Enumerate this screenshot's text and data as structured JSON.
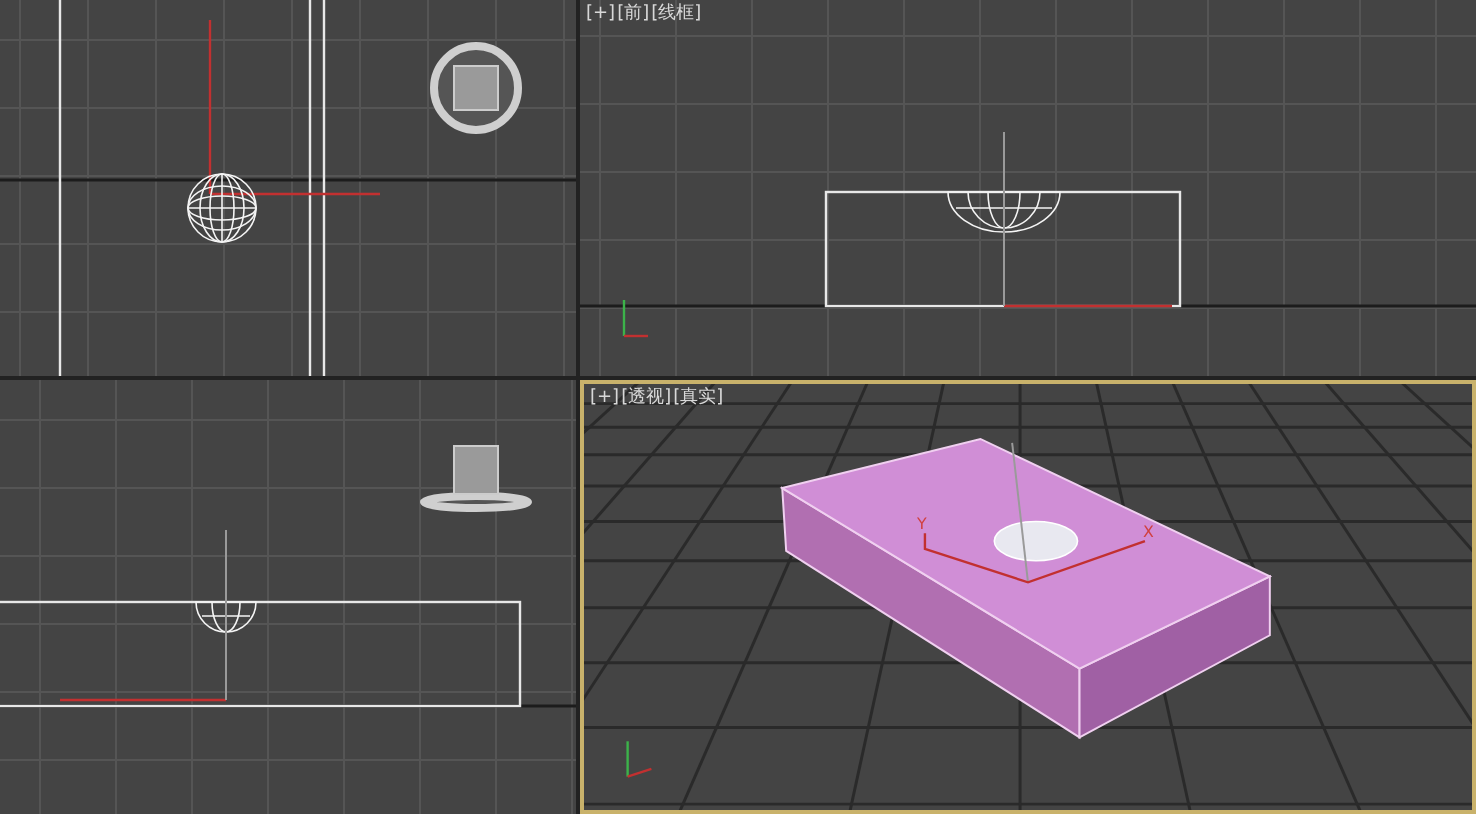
{
  "viewports": [
    {
      "kind": "top",
      "selected": false
    },
    {
      "kind": "front",
      "selected": false,
      "labels": [
        "[+]",
        "[前]",
        "[线框]"
      ]
    },
    {
      "kind": "left",
      "selected": false
    },
    {
      "kind": "perspective",
      "selected": true,
      "labels": [
        "[+]",
        "[透视]",
        "[真实]"
      ],
      "gizmo_labels": [
        "Y",
        "X"
      ]
    }
  ]
}
